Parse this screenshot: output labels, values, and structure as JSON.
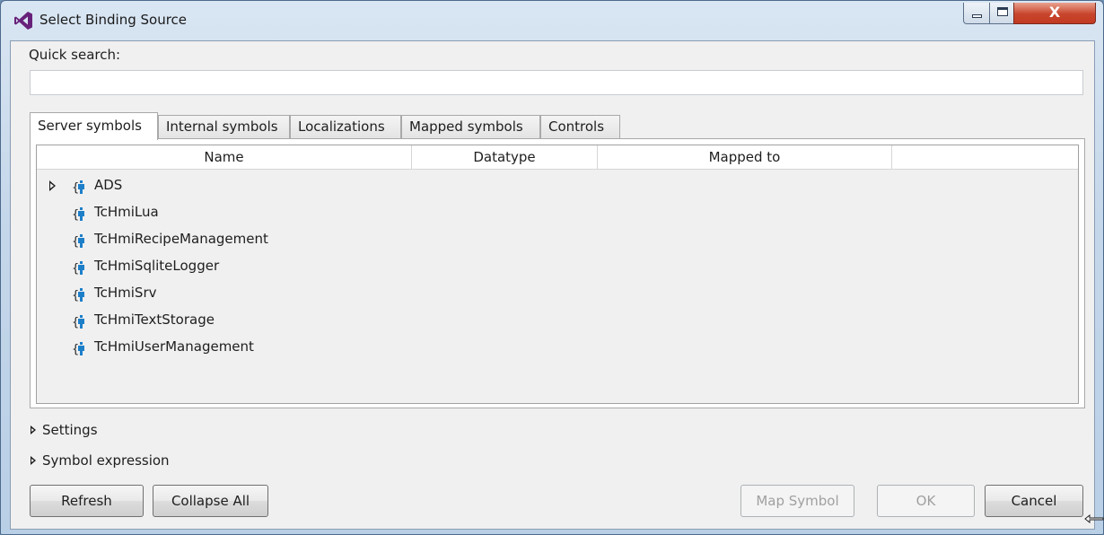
{
  "window": {
    "title": "Select Binding Source",
    "controls": {
      "minimize": "minimize-icon",
      "maximize": "maximize-icon",
      "close": "X"
    }
  },
  "quick_search": {
    "label": "Quick search:",
    "value": "",
    "placeholder": ""
  },
  "tabs": [
    {
      "label": "Server symbols",
      "active": true
    },
    {
      "label": "Internal symbols",
      "active": false
    },
    {
      "label": "Localizations",
      "active": false
    },
    {
      "label": "Mapped symbols",
      "active": false
    },
    {
      "label": "Controls",
      "active": false
    }
  ],
  "table": {
    "columns": [
      "Name",
      "Datatype",
      "Mapped to",
      ""
    ],
    "rows": [
      {
        "name": "ADS",
        "expandable": true,
        "icon": "symbol-icon"
      },
      {
        "name": "TcHmiLua",
        "expandable": false,
        "icon": "symbol-icon"
      },
      {
        "name": "TcHmiRecipeManagement",
        "expandable": false,
        "icon": "symbol-icon"
      },
      {
        "name": "TcHmiSqliteLogger",
        "expandable": false,
        "icon": "symbol-icon"
      },
      {
        "name": "TcHmiSrv",
        "expandable": false,
        "icon": "symbol-icon"
      },
      {
        "name": "TcHmiTextStorage",
        "expandable": false,
        "icon": "symbol-icon"
      },
      {
        "name": "TcHmiUserManagement",
        "expandable": false,
        "icon": "symbol-icon"
      }
    ]
  },
  "sections": [
    {
      "label": "Settings"
    },
    {
      "label": "Symbol expression"
    }
  ],
  "buttons": {
    "refresh": "Refresh",
    "collapse_all": "Collapse All",
    "map_symbol": "Map Symbol",
    "ok": "OK",
    "cancel": "Cancel"
  },
  "colors": {
    "accent_icon": "#1e7fc9",
    "app_icon": "#68217a"
  }
}
